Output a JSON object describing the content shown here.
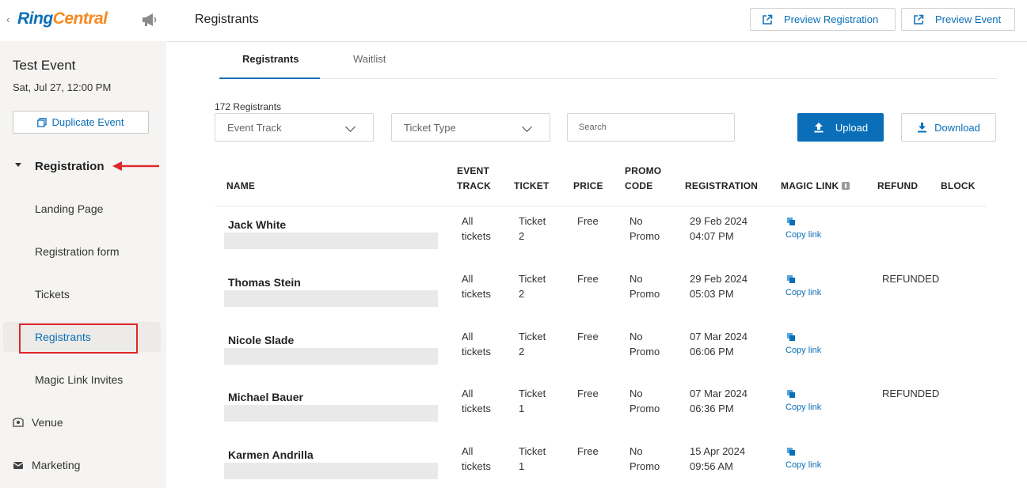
{
  "brand": {
    "ring": "Ring",
    "central": "Central"
  },
  "event": {
    "title": "Test Event",
    "date": "Sat, Jul 27, 12:00 PM",
    "duplicate_label": "Duplicate Event"
  },
  "nav": {
    "section_label": "Registration",
    "sub_items": [
      "Landing Page",
      "Registration form",
      "Tickets",
      "Registrants",
      "Magic Link Invites"
    ],
    "active_sub": "Registrants",
    "top_items": [
      {
        "label": "Venue",
        "icon": "venue-icon"
      },
      {
        "label": "Marketing",
        "icon": "marketing-icon"
      }
    ]
  },
  "header": {
    "title": "Registrants",
    "preview_registration": "Preview Registration",
    "preview_event": "Preview Event"
  },
  "tabs": [
    "Registrants",
    "Waitlist"
  ],
  "filters": {
    "count": "172 Registrants",
    "event_track": "Event Track",
    "ticket_type": "Ticket Type",
    "search_placeholder": "Search",
    "upload": "Upload",
    "download": "Download"
  },
  "table": {
    "columns": {
      "name": "NAME",
      "event_track_1": "EVENT",
      "event_track_2": "TRACK",
      "ticket": "TICKET",
      "price": "PRICE",
      "promo_1": "PROMO",
      "promo_2": "CODE",
      "registration": "REGISTRATION",
      "magic_link": "MAGIC LINK",
      "refund": "REFUND",
      "block": "BLOCK"
    },
    "rows": [
      {
        "name": "Jack White",
        "track_1": "All",
        "track_2": "tickets",
        "ticket_1": "Ticket",
        "ticket_2": "2",
        "price": "Free",
        "promo_1": "No",
        "promo_2": "Promo",
        "date": "29 Feb 2024",
        "time": "04:07 PM",
        "copy": "Copy link",
        "refund": ""
      },
      {
        "name": "Thomas Stein",
        "track_1": "All",
        "track_2": "tickets",
        "ticket_1": "Ticket",
        "ticket_2": "2",
        "price": "Free",
        "promo_1": "No",
        "promo_2": "Promo",
        "date": "29 Feb 2024",
        "time": "05:03 PM",
        "copy": "Copy link",
        "refund": "REFUNDED"
      },
      {
        "name": "Nicole Slade",
        "track_1": "All",
        "track_2": "tickets",
        "ticket_1": "Ticket",
        "ticket_2": "2",
        "price": "Free",
        "promo_1": "No",
        "promo_2": "Promo",
        "date": "07 Mar 2024",
        "time": "06:06 PM",
        "copy": "Copy link",
        "refund": ""
      },
      {
        "name": "Michael Bauer",
        "track_1": "All",
        "track_2": "tickets",
        "ticket_1": "Ticket",
        "ticket_2": "1",
        "price": "Free",
        "promo_1": "No",
        "promo_2": "Promo",
        "date": "07 Mar 2024",
        "time": "06:36 PM",
        "copy": "Copy link",
        "refund": "REFUNDED"
      },
      {
        "name": "Karmen Andrilla",
        "track_1": "All",
        "track_2": "tickets",
        "ticket_1": "Ticket",
        "ticket_2": "1",
        "price": "Free",
        "promo_1": "No",
        "promo_2": "Promo",
        "date": "15 Apr 2024",
        "time": "09:56 AM",
        "copy": "Copy link",
        "refund": ""
      }
    ]
  },
  "colors": {
    "accent": "#0a6fb8",
    "brand_orange": "#f7881f",
    "highlight_red": "#e0262a"
  }
}
